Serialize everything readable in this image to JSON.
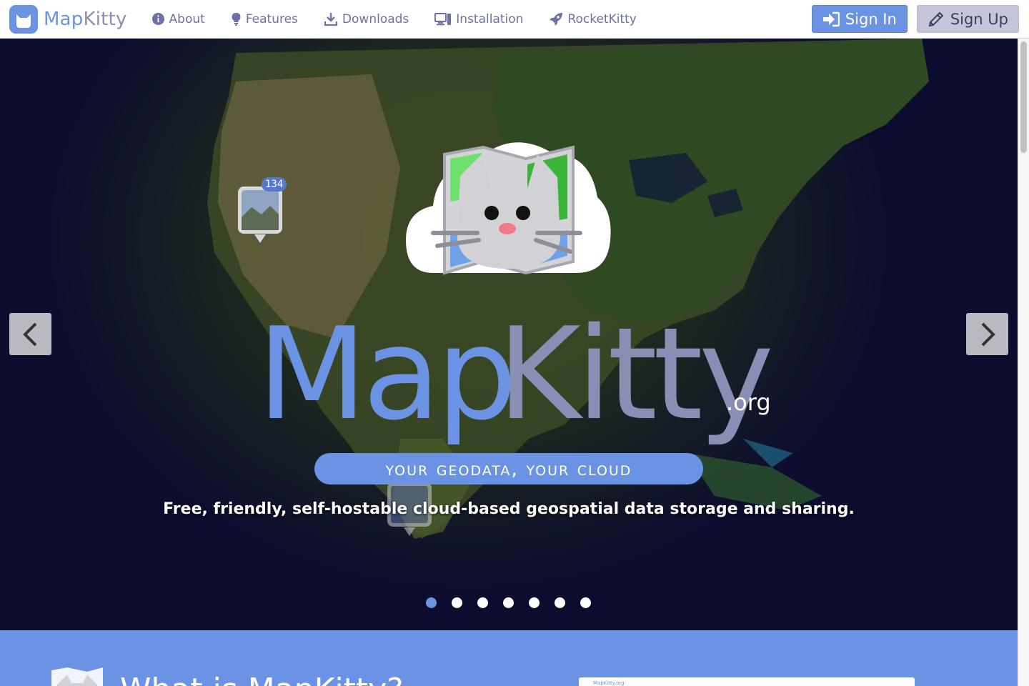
{
  "brand": {
    "name_part1": "Map",
    "name_part2": "Kitty"
  },
  "nav": {
    "items": [
      {
        "label": "About",
        "icon": "info-icon"
      },
      {
        "label": "Features",
        "icon": "lightbulb-icon"
      },
      {
        "label": "Downloads",
        "icon": "download-icon"
      },
      {
        "label": "Installation",
        "icon": "desktop-icon"
      },
      {
        "label": "RocketKitty",
        "icon": "rocket-icon"
      }
    ]
  },
  "auth": {
    "signin_label": "Sign In",
    "signup_label": "Sign Up"
  },
  "hero": {
    "title_part1": "Map",
    "title_part2": "Kitty",
    "domain_suffix": ".org",
    "tagline": "your geodata, your cloud",
    "description": "Free, friendly, self-hostable cloud-based geospatial data storage and sharing.",
    "marker_count": "134",
    "slides": {
      "count": 7,
      "active": 0
    }
  },
  "section": {
    "heading": "What is MapKitty?",
    "preview_title": "MapKitty.org"
  },
  "colors": {
    "accent": "#6c92e4",
    "secondary": "#8b8eb4",
    "nav_text": "#6d71a6",
    "signup_bg": "#c5c6db"
  }
}
